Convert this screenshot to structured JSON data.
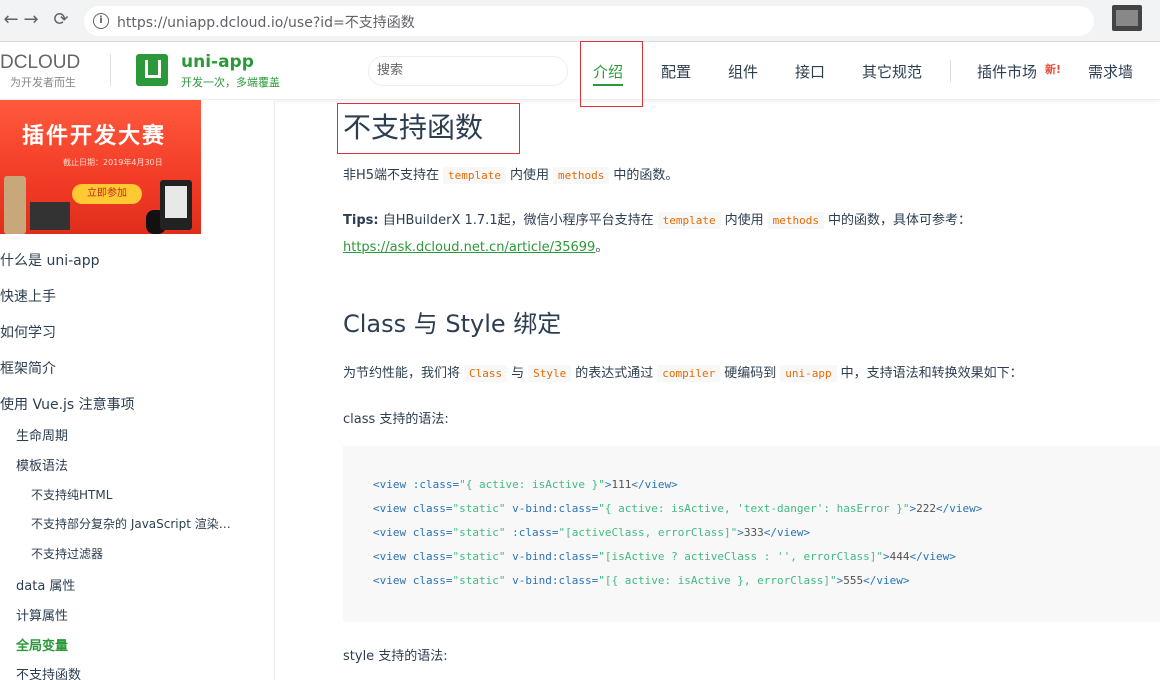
{
  "browser": {
    "back": "←",
    "forward": "→",
    "reload": "⟳",
    "url": "https://uniapp.dcloud.io/use?id=不支持函数"
  },
  "header": {
    "dcloud_logo": "DCLOUD",
    "dcloud_slogan": "为开发者而生",
    "uni_title": "uni-app",
    "uni_slogan": "开发一次，多端覆盖",
    "search_placeholder": "搜索",
    "nav": [
      {
        "label": "介绍",
        "active": true
      },
      {
        "label": "配置"
      },
      {
        "label": "组件"
      },
      {
        "label": "接口"
      },
      {
        "label": "其它规范"
      },
      {
        "label": "插件市场"
      },
      {
        "label": "需求墙"
      }
    ],
    "new_badge": "新!"
  },
  "sidebar": {
    "banner": {
      "title": "插件开发大赛",
      "date": "截止日期：2019年4月30日",
      "button": "立即参加"
    },
    "items": [
      {
        "label": "什么是 uni-app",
        "level": 1
      },
      {
        "label": "快速上手",
        "level": 1
      },
      {
        "label": "如何学习",
        "level": 1
      },
      {
        "label": "框架简介",
        "level": 1
      },
      {
        "label": "使用 Vue.js 注意事项",
        "level": 1
      },
      {
        "label": "生命周期",
        "level": 2
      },
      {
        "label": "模板语法",
        "level": 2
      },
      {
        "label": "不支持纯HTML",
        "level": 3
      },
      {
        "label": "不支持部分复杂的 JavaScript 渲染…",
        "level": 3
      },
      {
        "label": "不支持过滤器",
        "level": 3
      },
      {
        "label": "data 属性",
        "level": 2
      },
      {
        "label": "计算属性",
        "level": 2
      },
      {
        "label": "全局变量",
        "level": 2,
        "current": true
      },
      {
        "label": "不支持函数",
        "level": 2
      }
    ]
  },
  "content": {
    "h1": "不支持函数",
    "p1": {
      "before": "非H5端不支持在",
      "code1": "template",
      "middle": "内使用",
      "code2": "methods",
      "after": "中的函数。"
    },
    "tips": {
      "label": "Tips:",
      "before": "自HBuilderX 1.7.1起，微信小程序平台支持在",
      "code1": "template",
      "middle": "内使用",
      "code2": "methods",
      "after": "中的函数，具体可参考：",
      "link": "https://ask.dcloud.net.cn/article/35699",
      "link_after": "。"
    },
    "h2": "Class 与 Style 绑定",
    "p2": {
      "t1": "为节约性能，我们将",
      "c1": "Class",
      "t2": "与",
      "c2": "Style",
      "t3": "的表达式通过",
      "c3": "compiler",
      "t4": "硬编码到",
      "c4": "uni-app",
      "t5": "中，支持语法和转换效果如下："
    },
    "class_syntax": "class 支持的语法:",
    "code_lines": [
      [
        [
          "tag",
          "<view "
        ],
        [
          "attr",
          ":class"
        ],
        [
          "tag",
          "="
        ],
        [
          "str",
          "\"{ active: isActive }\""
        ],
        [
          "tag",
          ">"
        ],
        [
          "txt",
          "111"
        ],
        [
          "tag",
          "</view>"
        ]
      ],
      [
        [
          "tag",
          "<view "
        ],
        [
          "attr",
          "class"
        ],
        [
          "tag",
          "="
        ],
        [
          "str",
          "\"static\" "
        ],
        [
          "attr",
          "v-bind:class"
        ],
        [
          "tag",
          "="
        ],
        [
          "str",
          "\"{ active: isActive, 'text-danger': hasError }\""
        ],
        [
          "tag",
          ">"
        ],
        [
          "txt",
          "222"
        ],
        [
          "tag",
          "</view>"
        ]
      ],
      [
        [
          "tag",
          "<view "
        ],
        [
          "attr",
          "class"
        ],
        [
          "tag",
          "="
        ],
        [
          "str",
          "\"static\" "
        ],
        [
          "attr",
          ":class"
        ],
        [
          "tag",
          "="
        ],
        [
          "str",
          "\"[activeClass, errorClass]\""
        ],
        [
          "tag",
          ">"
        ],
        [
          "txt",
          "333"
        ],
        [
          "tag",
          "</view>"
        ]
      ],
      [
        [
          "tag",
          "<view "
        ],
        [
          "attr",
          "class"
        ],
        [
          "tag",
          "="
        ],
        [
          "str",
          "\"static\" "
        ],
        [
          "attr",
          "v-bind:class"
        ],
        [
          "tag",
          "="
        ],
        [
          "str",
          "\"[isActive ? activeClass : '', errorClass]\""
        ],
        [
          "tag",
          ">"
        ],
        [
          "txt",
          "444"
        ],
        [
          "tag",
          "</view>"
        ]
      ],
      [
        [
          "tag",
          "<view "
        ],
        [
          "attr",
          "class"
        ],
        [
          "tag",
          "="
        ],
        [
          "str",
          "\"static\" "
        ],
        [
          "attr",
          "v-bind:class"
        ],
        [
          "tag",
          "="
        ],
        [
          "str",
          "\"[{ active: isActive }, errorClass]\""
        ],
        [
          "tag",
          ">"
        ],
        [
          "txt",
          "555"
        ],
        [
          "tag",
          "</view>"
        ]
      ]
    ],
    "style_syntax": "style 支持的语法:"
  }
}
